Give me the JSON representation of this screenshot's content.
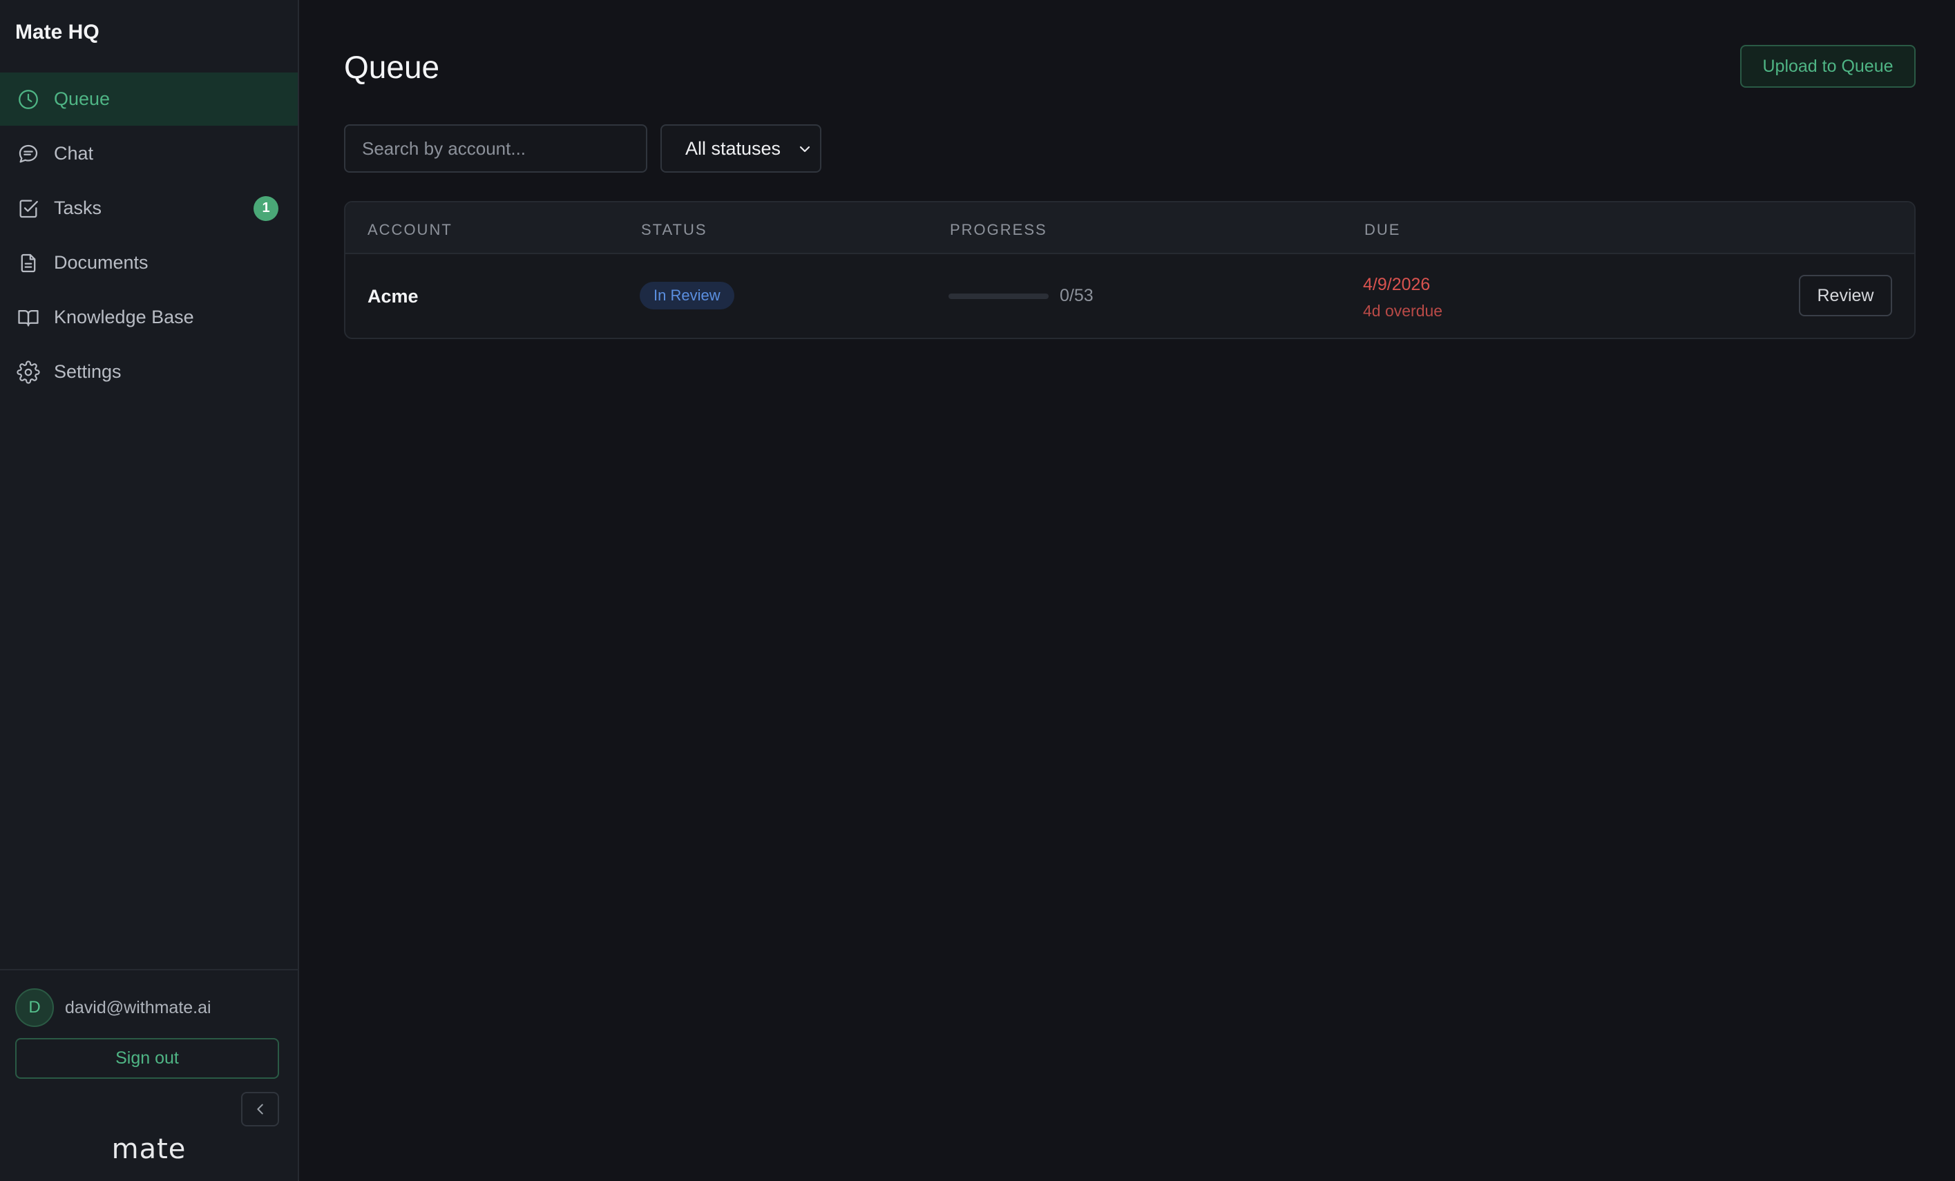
{
  "app": {
    "brand": "Mate HQ",
    "logo_text": "mate"
  },
  "colors": {
    "accent": "#4fb585",
    "active_bg": "#17332b",
    "overdue": "#d9534f",
    "in_review_text": "#5b8fe0",
    "in_review_bg": "#1d2a44",
    "background": "#121318",
    "sidebar_bg": "#181b21"
  },
  "sidebar": {
    "items": [
      {
        "label": "Queue",
        "icon": "clock-icon",
        "active": true
      },
      {
        "label": "Chat",
        "icon": "chat-bubble-icon"
      },
      {
        "label": "Tasks",
        "icon": "checkbox-icon",
        "badge": "1"
      },
      {
        "label": "Documents",
        "icon": "document-icon"
      },
      {
        "label": "Knowledge Base",
        "icon": "book-icon"
      },
      {
        "label": "Settings",
        "icon": "gear-icon"
      }
    ],
    "user": {
      "initial": "D",
      "email": "david@withmate.ai"
    },
    "sign_out_label": "Sign out",
    "collapse_icon": "chevron-left-icon"
  },
  "main": {
    "title": "Queue",
    "upload_label": "Upload to Queue",
    "search": {
      "placeholder": "Search by account...",
      "value": ""
    },
    "status_filter": {
      "selected": "All statuses"
    },
    "table": {
      "columns": [
        "ACCOUNT",
        "STATUS",
        "PROGRESS",
        "DUE"
      ],
      "rows": [
        {
          "account": "Acme",
          "status": "In Review",
          "progress_done": 0,
          "progress_total": 53,
          "progress_text": "0/53",
          "due_date": "4/9/2026",
          "due_note": "4d overdue",
          "action": "Review"
        }
      ]
    }
  }
}
